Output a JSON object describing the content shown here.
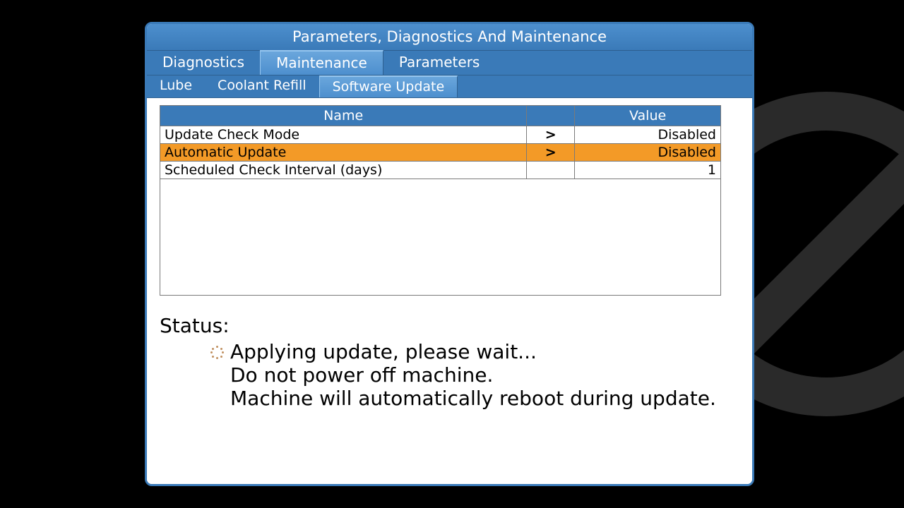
{
  "window": {
    "title": "Parameters, Diagnostics And Maintenance"
  },
  "tabs_primary": [
    {
      "label": "Diagnostics",
      "active": false
    },
    {
      "label": "Maintenance",
      "active": true
    },
    {
      "label": "Parameters",
      "active": false
    }
  ],
  "tabs_secondary": [
    {
      "label": "Lube",
      "active": false
    },
    {
      "label": "Coolant Refill",
      "active": false
    },
    {
      "label": "Software Update",
      "active": true
    }
  ],
  "table": {
    "headers": {
      "name": "Name",
      "value": "Value"
    },
    "rows": [
      {
        "name": "Update Check Mode",
        "arrow": ">",
        "value": "Disabled",
        "selected": false
      },
      {
        "name": "Automatic Update",
        "arrow": ">",
        "value": "Disabled",
        "selected": true
      },
      {
        "name": "Scheduled Check Interval (days)",
        "arrow": "",
        "value": "1",
        "selected": false
      }
    ]
  },
  "status": {
    "label": "Status:",
    "lines": [
      "Applying update, please wait...",
      "Do not power off machine.",
      "Machine will automatically reboot during update."
    ]
  }
}
